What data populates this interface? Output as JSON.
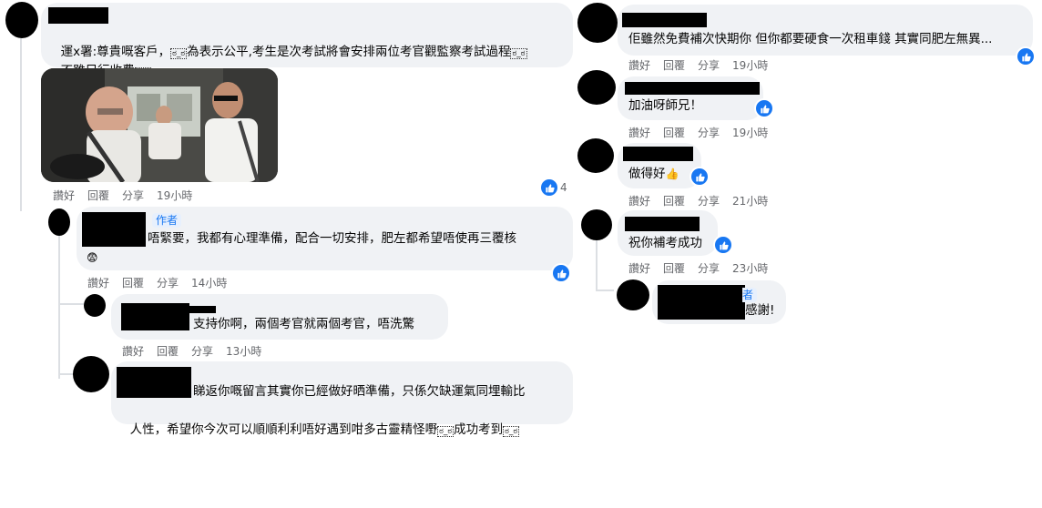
{
  "left": {
    "c1": {
      "line1": "運x署:尊貴嘅客戶，",
      "line1_tail": "為表示公平,考生是次考試將會安排兩位考官觀監察考試過程",
      "line2": "不雖另行收費",
      "reply": "回覆",
      "like": "讚好",
      "share": "分享",
      "time": "19小時",
      "reaction_count": "4"
    },
    "c2": {
      "badge": "作者",
      "line1": "唔緊要，我都有心理準備，配合一切安排，肥左都希望唔使再三覆核",
      "emoji": "😨",
      "like": "讚好",
      "reply": "回覆",
      "share": "分享",
      "time": "14小時"
    },
    "c3": {
      "text": "支持你啊，兩個考官就兩個考官，唔洗驚",
      "like": "讚好",
      "reply": "回覆",
      "share": "分享",
      "time": "13小時"
    },
    "c4": {
      "line1": "睇返你嘅留言其實你已經做好晒準備，只係欠缺運氣同埋輸比",
      "line2": "人性，希望你今次可以順順利利唔好遇到咁多古靈精怪嘢",
      "line2_tail": "成功考到"
    }
  },
  "right": {
    "r1": {
      "text": "佢雖然免費補次快期你 但你都要硬食一次租車錢 其實同肥左無異...",
      "like": "讚好",
      "reply": "回覆",
      "share": "分享",
      "time": "19小時"
    },
    "r2": {
      "text": "加油呀師兄！",
      "like": "讚好",
      "reply": "回覆",
      "share": "分享",
      "time": "19小時"
    },
    "r3": {
      "text": "做得好",
      "emoji": "👍",
      "like": "讚好",
      "reply": "回覆",
      "share": "分享",
      "time": "21小時"
    },
    "r4": {
      "text": "祝你補考成功",
      "like": "讚好",
      "reply": "回覆",
      "share": "分享",
      "time": "23小時"
    },
    "r5": {
      "badge": "者",
      "text": "感謝!"
    }
  },
  "colors": {
    "bubble": "#f0f2f5",
    "meta": "#65676b",
    "like_blue": "#1877f2",
    "thread_line": "#dcdfe3"
  },
  "icons": {
    "reaction": "like-thumb-icon"
  }
}
